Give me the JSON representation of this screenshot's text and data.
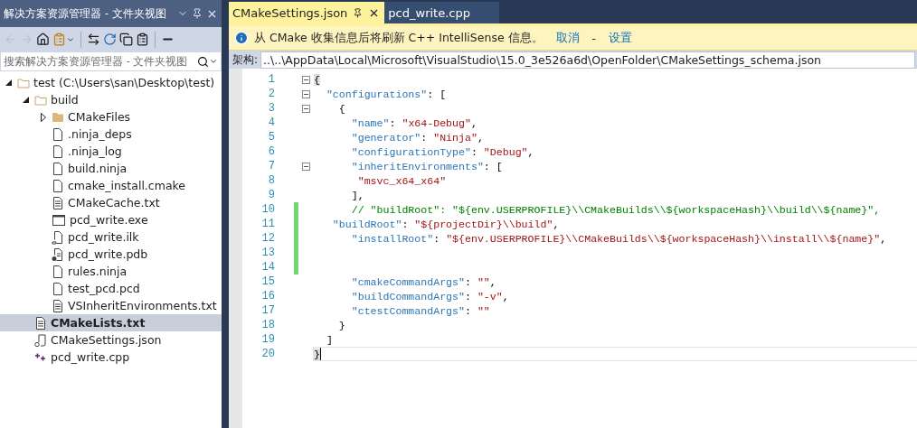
{
  "explorer": {
    "title": "解决方案资源管理器 - 文件夹视图",
    "toolbar": [
      {
        "kind": "back",
        "disabled": true
      },
      {
        "kind": "forward",
        "disabled": true
      },
      {
        "kind": "home",
        "disabled": false
      },
      {
        "kind": "sync",
        "disabled": false
      },
      {
        "kind": "separator"
      },
      {
        "kind": "switch",
        "disabled": false
      },
      {
        "kind": "refresh",
        "disabled": false
      },
      {
        "kind": "collapse",
        "disabled": false
      },
      {
        "kind": "properties",
        "disabled": false
      },
      {
        "kind": "separator"
      },
      {
        "kind": "minus",
        "disabled": false
      }
    ],
    "search": {
      "placeholder": "搜索解决方案资源管理器 - 文件夹视图"
    },
    "tree": [
      {
        "label": "test (C:\\Users\\san\\Desktop\\test)",
        "kind": "folder",
        "expanded": true,
        "selected": false,
        "children": [
          {
            "label": "build",
            "kind": "folder",
            "expanded": true,
            "selected": false,
            "children": [
              {
                "label": "CMakeFiles",
                "kind": "folder-closed",
                "expanded": false,
                "selected": false
              },
              {
                "label": ".ninja_deps",
                "kind": "file",
                "selected": false
              },
              {
                "label": ".ninja_log",
                "kind": "file",
                "selected": false
              },
              {
                "label": "build.ninja",
                "kind": "file",
                "selected": false
              },
              {
                "label": "cmake_install.cmake",
                "kind": "file",
                "selected": false
              },
              {
                "label": "CMakeCache.txt",
                "kind": "text",
                "selected": false
              },
              {
                "label": "pcd_write.exe",
                "kind": "exe",
                "selected": false
              },
              {
                "label": "pcd_write.ilk",
                "kind": "ilk",
                "selected": false
              },
              {
                "label": "pcd_write.pdb",
                "kind": "pdb",
                "selected": false
              },
              {
                "label": "rules.ninja",
                "kind": "file",
                "selected": false
              },
              {
                "label": "test_pcd.pcd",
                "kind": "file",
                "selected": false
              },
              {
                "label": "VSInheritEnvironments.txt",
                "kind": "text",
                "selected": false
              }
            ]
          },
          {
            "label": "CMakeLists.txt",
            "kind": "text",
            "selected": true
          },
          {
            "label": "CMakeSettings.json",
            "kind": "settings",
            "selected": false
          },
          {
            "label": "pcd_write.cpp",
            "kind": "cpp",
            "selected": false
          }
        ]
      }
    ]
  },
  "tabs": [
    {
      "label": "CMakeSettings.json",
      "selected": true
    },
    {
      "label": "pcd_write.cpp",
      "selected": false
    }
  ],
  "info_bar": {
    "message": "从 CMake 收集信息后将刷新 C++ IntelliSense 信息。",
    "links": [
      {
        "kind": "link",
        "text": "取消"
      },
      {
        "kind": "sep",
        "text": "-"
      },
      {
        "kind": "link",
        "text": "设置"
      }
    ]
  },
  "schema": {
    "label": "架构:",
    "value": "..\\..\\AppData\\Local\\Microsoft\\VisualStudio\\15.0_3e526a6d\\OpenFolder\\CMakeSettings_schema.json"
  },
  "editor": {
    "lines": [
      {
        "number": "1",
        "foldable": true,
        "changed": false,
        "current": false,
        "tokens": [
          {
            "kind": "match",
            "text": "{"
          }
        ]
      },
      {
        "number": "2",
        "foldable": true,
        "changed": false,
        "current": false,
        "tokens": [
          {
            "kind": "key",
            "text": "  \"configurations\""
          },
          {
            "kind": "punct",
            "text": ": ["
          }
        ]
      },
      {
        "number": "3",
        "foldable": true,
        "changed": false,
        "current": false,
        "tokens": [
          {
            "kind": "punct",
            "text": "    {"
          }
        ]
      },
      {
        "number": "4",
        "foldable": false,
        "changed": false,
        "current": false,
        "tokens": [
          {
            "kind": "key",
            "text": "      \"name\""
          },
          {
            "kind": "punct",
            "text": ": "
          },
          {
            "kind": "string",
            "text": "\"x64-Debug\""
          },
          {
            "kind": "punct",
            "text": ","
          }
        ]
      },
      {
        "number": "5",
        "foldable": false,
        "changed": false,
        "current": false,
        "tokens": [
          {
            "kind": "key",
            "text": "      \"generator\""
          },
          {
            "kind": "punct",
            "text": ": "
          },
          {
            "kind": "string",
            "text": "\"Ninja\""
          },
          {
            "kind": "punct",
            "text": ","
          }
        ]
      },
      {
        "number": "6",
        "foldable": false,
        "changed": false,
        "current": false,
        "tokens": [
          {
            "kind": "key",
            "text": "      \"configurationType\""
          },
          {
            "kind": "punct",
            "text": ": "
          },
          {
            "kind": "string",
            "text": "\"Debug\""
          },
          {
            "kind": "punct",
            "text": ","
          }
        ]
      },
      {
        "number": "7",
        "foldable": true,
        "changed": false,
        "current": false,
        "tokens": [
          {
            "kind": "key",
            "text": "      \"inheritEnvironments\""
          },
          {
            "kind": "punct",
            "text": ": ["
          }
        ]
      },
      {
        "number": "8",
        "foldable": false,
        "changed": false,
        "current": false,
        "tokens": [
          {
            "kind": "string",
            "text": "       \"msvc_x64_x64\""
          }
        ]
      },
      {
        "number": "9",
        "foldable": false,
        "changed": false,
        "current": false,
        "tokens": [
          {
            "kind": "punct",
            "text": "      ],"
          }
        ]
      },
      {
        "number": "10",
        "foldable": false,
        "changed": true,
        "current": false,
        "tokens": [
          {
            "kind": "comment",
            "text": "      // \"buildRoot\": \"${env.USERPROFILE}\\\\CMakeBuilds\\\\${workspaceHash}\\\\build\\\\${name}\","
          }
        ]
      },
      {
        "number": "11",
        "foldable": false,
        "changed": true,
        "current": false,
        "tokens": [
          {
            "kind": "key",
            "text": "   \"buildRoot\""
          },
          {
            "kind": "punct",
            "text": ": "
          },
          {
            "kind": "string",
            "text": "\"${projectDir}\\\\build\""
          },
          {
            "kind": "punct",
            "text": ","
          }
        ]
      },
      {
        "number": "12",
        "foldable": false,
        "changed": true,
        "current": false,
        "tokens": [
          {
            "kind": "key",
            "text": "      \"installRoot\""
          },
          {
            "kind": "punct",
            "text": ": "
          },
          {
            "kind": "string",
            "text": "\"${env.USERPROFILE}\\\\CMakeBuilds\\\\${workspaceHash}\\\\install\\\\${name}\""
          },
          {
            "kind": "punct",
            "text": ","
          }
        ]
      },
      {
        "number": "13",
        "foldable": false,
        "changed": true,
        "current": false
      },
      {
        "number": "14",
        "foldable": false,
        "changed": true,
        "current": false
      },
      {
        "number": "15",
        "foldable": false,
        "changed": false,
        "current": false,
        "tokens": [
          {
            "kind": "key",
            "text": "      \"cmakeCommandArgs\""
          },
          {
            "kind": "punct",
            "text": ": "
          },
          {
            "kind": "string",
            "text": "\"\""
          },
          {
            "kind": "punct",
            "text": ","
          }
        ]
      },
      {
        "number": "16",
        "foldable": false,
        "changed": false,
        "current": false,
        "tokens": [
          {
            "kind": "key",
            "text": "      \"buildCommandArgs\""
          },
          {
            "kind": "punct",
            "text": ": "
          },
          {
            "kind": "string",
            "text": "\"-v\""
          },
          {
            "kind": "punct",
            "text": ","
          }
        ]
      },
      {
        "number": "17",
        "foldable": false,
        "changed": false,
        "current": false,
        "tokens": [
          {
            "kind": "key",
            "text": "      \"ctestCommandArgs\""
          },
          {
            "kind": "punct",
            "text": ": "
          },
          {
            "kind": "string",
            "text": "\"\""
          }
        ]
      },
      {
        "number": "18",
        "foldable": false,
        "changed": false,
        "current": false,
        "tokens": [
          {
            "kind": "punct",
            "text": "    }"
          }
        ]
      },
      {
        "number": "19",
        "foldable": false,
        "changed": false,
        "current": false,
        "tokens": [
          {
            "kind": "punct",
            "text": "  ]"
          }
        ]
      },
      {
        "number": "20",
        "foldable": false,
        "changed": false,
        "current": true,
        "tokens": [
          {
            "kind": "match",
            "text": "}"
          }
        ]
      }
    ]
  }
}
